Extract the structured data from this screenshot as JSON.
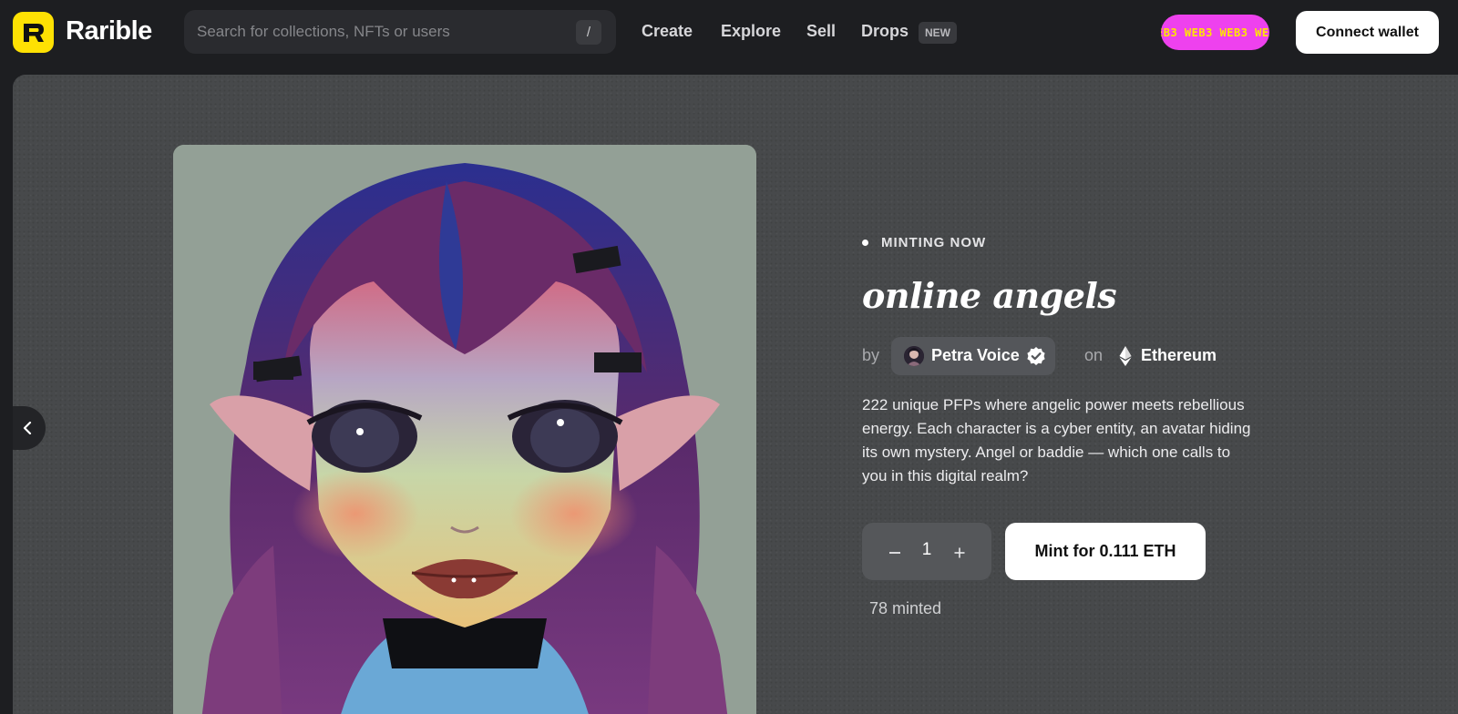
{
  "header": {
    "logo_text": "Rarible",
    "search": {
      "placeholder": "Search for collections, NFTs or users",
      "shortcut": "/"
    },
    "nav": [
      {
        "label": "Create"
      },
      {
        "label": "Explore"
      },
      {
        "label": "Sell"
      },
      {
        "label": "Drops"
      }
    ],
    "drops_badge": "NEW",
    "promo_pill": "EB3 WEB3 WEB3 WEB3 W",
    "connect_wallet": "Connect wallet"
  },
  "drop": {
    "status": "MINTING NOW",
    "title": "online angels",
    "by_label": "by",
    "creator": "Petra Voice",
    "on_label": "on",
    "chain": "Ethereum",
    "description": "222 unique PFPs where angelic power meets rebellious energy. Each character is a cyber entity, an avatar hiding its own mystery. Angel or baddie — which one calls to you in this digital realm?",
    "quantity": "1",
    "mint_button": "Mint for 0.111 ETH",
    "minted": "78 minted"
  },
  "colors": {
    "logo_badge": "#fee103",
    "promo_pill_bg": "#ee41ee",
    "promo_pill_text": "#ffe600",
    "page_bg": "#1d1e21",
    "hero_bg": "#47494b"
  },
  "icons": {
    "prev": "chevron-left-icon",
    "chain": "ethereum-icon",
    "verified": "verified-badge-icon",
    "minus": "minus-icon",
    "plus": "plus-icon"
  }
}
